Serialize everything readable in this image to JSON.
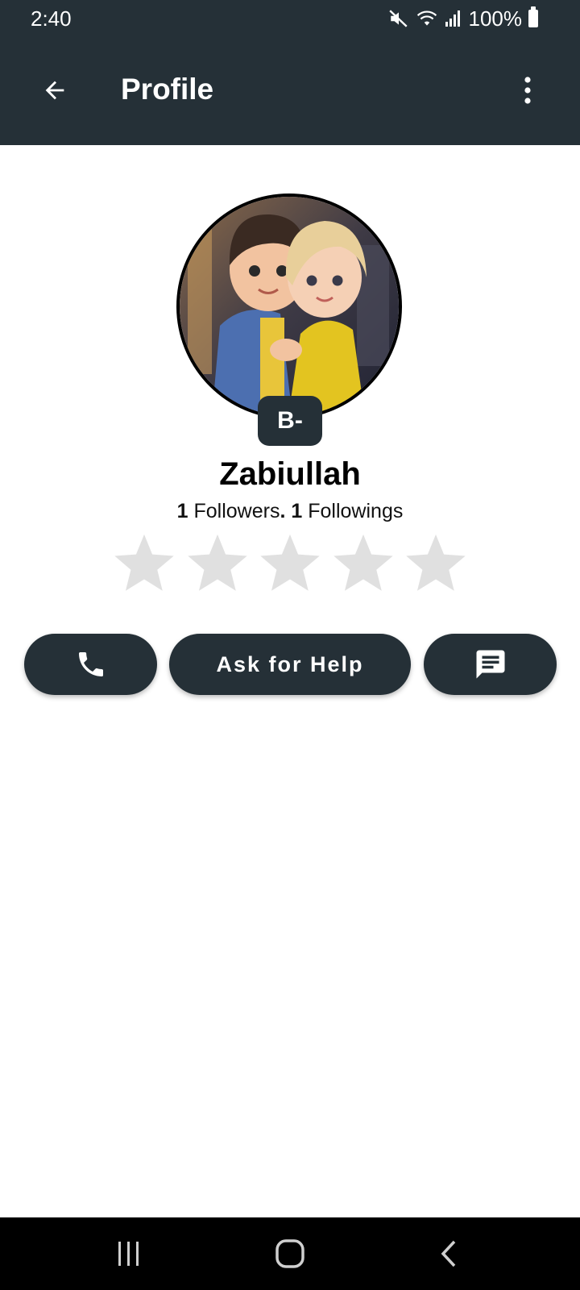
{
  "status_bar": {
    "time": "2:40",
    "battery_percent": "100%",
    "icons": [
      "mute-icon",
      "wifi-icon",
      "signal-icon",
      "battery-icon"
    ]
  },
  "app_bar": {
    "title": "Profile",
    "back_icon": "arrow-left-icon",
    "menu_icon": "more-vertical-icon"
  },
  "profile": {
    "avatar_alt": "profile photo",
    "grade": "B-",
    "name": "Zabiullah",
    "followers_count": "1",
    "followers_label": "Followers",
    "separator": ".",
    "followings_count": "1",
    "followings_label": "Followings",
    "rating": 0,
    "rating_max": 5
  },
  "actions": {
    "call_icon": "phone-icon",
    "help_label": "Ask for Help",
    "message_icon": "chat-icon"
  },
  "colors": {
    "primary": "#253037",
    "star_empty": "#e0e0e0",
    "background": "#ffffff"
  },
  "nav_bar": {
    "items": [
      "recent-apps-icon",
      "home-icon",
      "back-icon"
    ]
  }
}
